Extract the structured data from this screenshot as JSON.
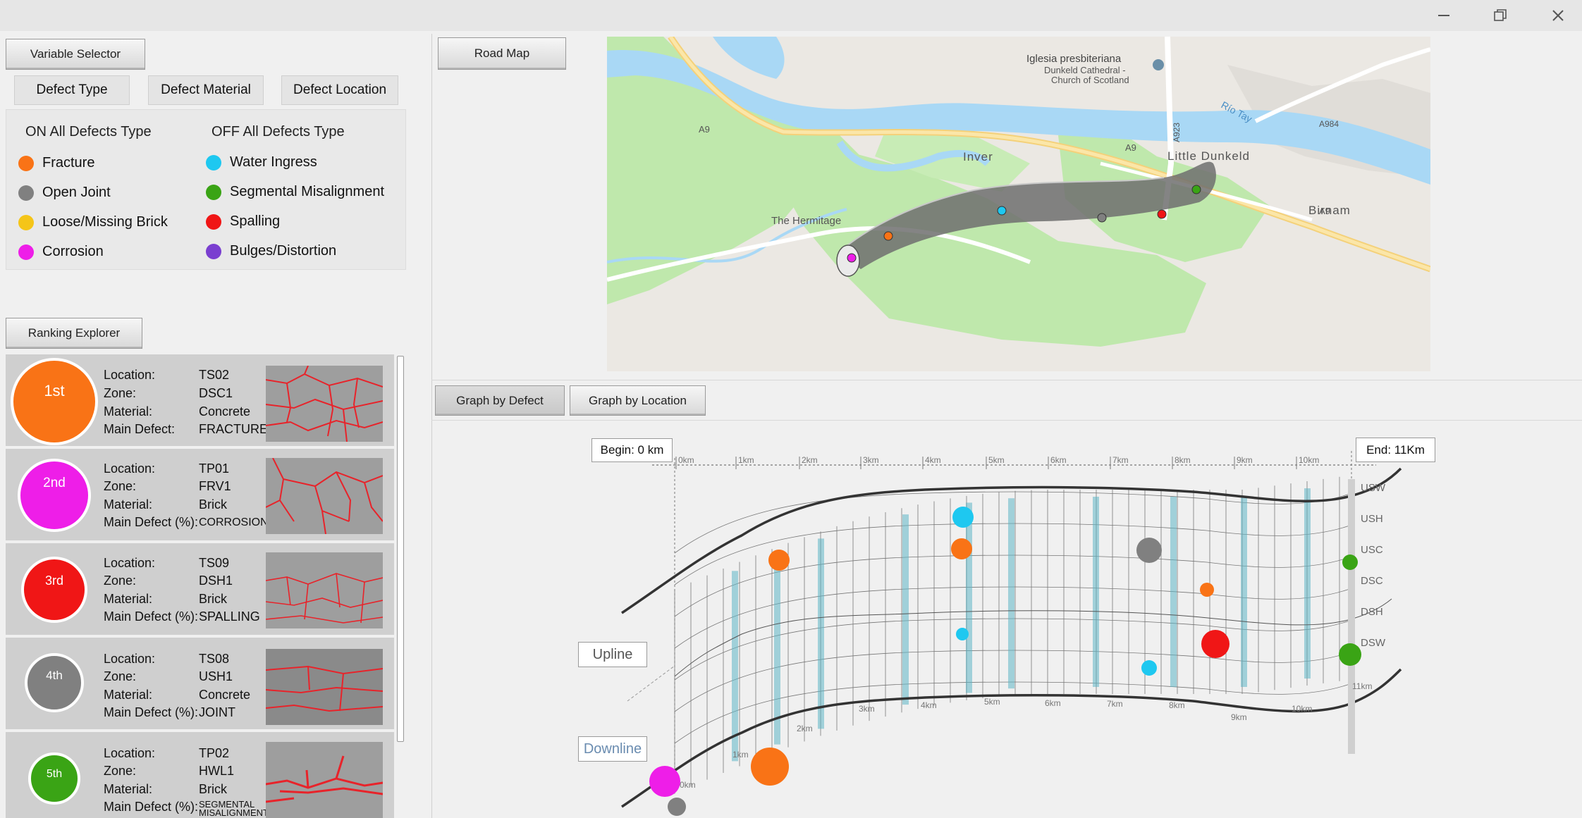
{
  "window": {
    "minimize_icon": "minimize-icon",
    "maximize_icon": "restore-icon",
    "close_icon": "close-icon"
  },
  "variable_selector": {
    "title": "Variable Selector",
    "tabs": [
      "Defect Type",
      "Defect Material",
      "Defect Location"
    ],
    "on_label": "ON All Defects Type",
    "off_label": "OFF All Defects Type",
    "defects_left": [
      {
        "label": "Fracture",
        "color": "#f97316"
      },
      {
        "label": "Open Joint",
        "color": "#808080"
      },
      {
        "label": "Loose/Missing Brick",
        "color": "#f5c518"
      },
      {
        "label": "Corrosion",
        "color": "#ee1ee8"
      }
    ],
    "defects_right": [
      {
        "label": "Water Ingress",
        "color": "#1ec8f0"
      },
      {
        "label": "Segmental Misalignment",
        "color": "#3aa415"
      },
      {
        "label": "Spalling",
        "color": "#f01616"
      },
      {
        "label": "Bulges/Distortion",
        "color": "#7a3fd0"
      }
    ]
  },
  "ranking": {
    "title": "Ranking Explorer",
    "labels": {
      "location": "Location:",
      "zone": "Zone:",
      "material": "Material:",
      "main_defect": "Main Defect:",
      "main_defect_pct": "Main Defect (%):"
    },
    "items": [
      {
        "rank": "1st",
        "location": "TS02",
        "zone": "DSC1",
        "material": "Concrete",
        "defect": "FRACTURE",
        "color": "#f97316"
      },
      {
        "rank": "2nd",
        "location": "TP01",
        "zone": "FRV1",
        "material": "Brick",
        "defect": "CORROSION",
        "color": "#ee1ee8"
      },
      {
        "rank": "3rd",
        "location": "TS09",
        "zone": "DSH1",
        "material": "Brick",
        "defect": "SPALLING",
        "color": "#f01616"
      },
      {
        "rank": "4th",
        "location": "TS08",
        "zone": "USH1",
        "material": "Concrete",
        "defect": "JOINT",
        "color": "#808080"
      },
      {
        "rank": "5th",
        "location": "TP02",
        "zone": "HWL1",
        "material": "Brick",
        "defect": "SEGMENTAL MISALIGNMENT",
        "color": "#3aa415"
      }
    ]
  },
  "road_map": {
    "button": "Road Map",
    "places": {
      "church1": "Iglesia presbiteriana",
      "church2": "Dunkeld Cathedral -",
      "church3": "Church of Scotland",
      "inver": "Inver",
      "little_dunkeld": "Little Dunkeld",
      "birnam": "Birnam",
      "hermitage": "The Hermitage",
      "rio_tay": "Río Tay"
    },
    "roads": {
      "a9": "A9",
      "a923": "A923",
      "a984": "A984"
    }
  },
  "graph": {
    "tab_defect": "Graph by Defect",
    "tab_location": "Graph by Location",
    "begin": "Begin: 0 km",
    "end": "End: 11Km",
    "upline": "Upline",
    "downline": "Downline",
    "zones": [
      "USW",
      "USH",
      "USC",
      "DSC",
      "DSH",
      "DSW"
    ],
    "km_labels": [
      "0km",
      "1km",
      "2km",
      "3km",
      "4km",
      "5km",
      "6km",
      "7km",
      "8km",
      "9km",
      "10km",
      "11km"
    ]
  }
}
